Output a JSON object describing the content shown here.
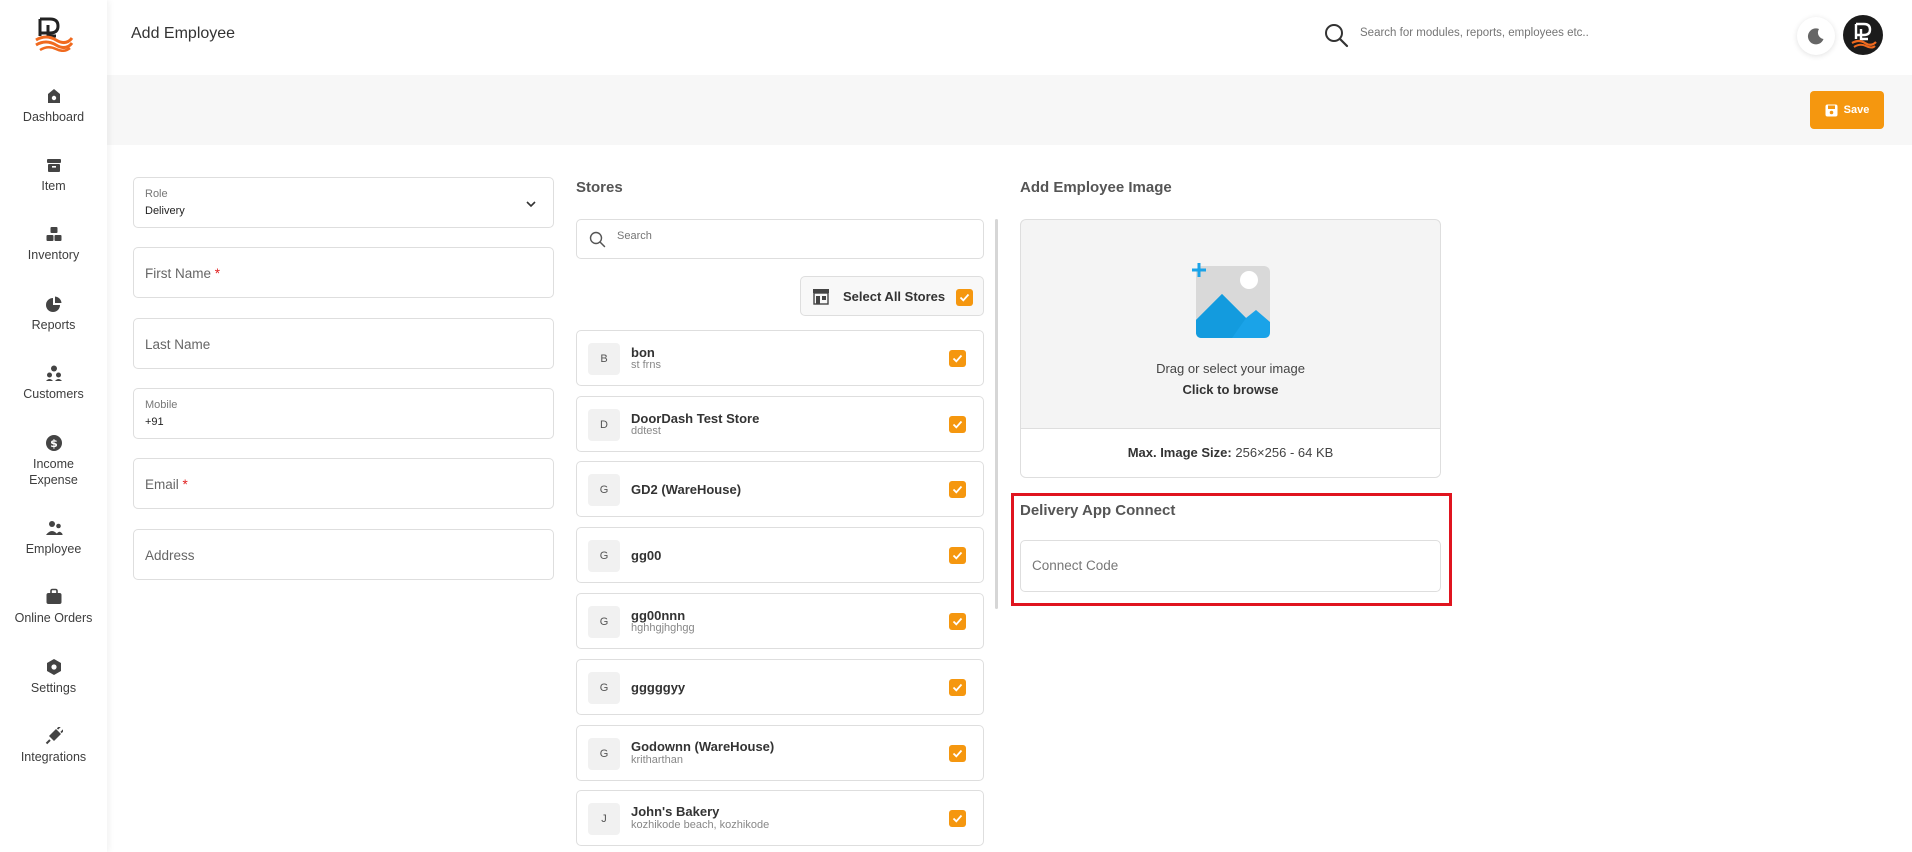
{
  "nav": {
    "items": [
      {
        "label": "Dashboard",
        "icon": "dashboard-icon"
      },
      {
        "label": "Item",
        "icon": "item-icon"
      },
      {
        "label": "Inventory",
        "icon": "inventory-icon"
      },
      {
        "label": "Reports",
        "icon": "pie-chart-icon"
      },
      {
        "label": "Customers",
        "icon": "customers-icon"
      },
      {
        "label": "Income Expense",
        "icon": "dollar-icon"
      },
      {
        "label": "Employee",
        "icon": "employee-icon"
      },
      {
        "label": "Online Orders",
        "icon": "bag-icon"
      },
      {
        "label": "Settings",
        "icon": "settings-icon"
      },
      {
        "label": "Integrations",
        "icon": "plug-icon"
      }
    ]
  },
  "header": {
    "title": "Add Employee",
    "search_placeholder": "Search for modules, reports, employees etc.."
  },
  "toolbar": {
    "save_label": "Save"
  },
  "form": {
    "role_label": "Role",
    "role_value": "Delivery",
    "first_name": "First Name",
    "last_name": "Last Name",
    "mobile_label": "Mobile",
    "mobile_value": "+91",
    "email": "Email",
    "address": "Address",
    "required_mark": "*"
  },
  "stores": {
    "title": "Stores",
    "search_placeholder": "Search",
    "select_all_label": "Select All Stores",
    "items": [
      {
        "initial": "B",
        "name": "bon",
        "sub": "st frns"
      },
      {
        "initial": "D",
        "name": "DoorDash Test Store",
        "sub": "ddtest"
      },
      {
        "initial": "G",
        "name": "GD2 (WareHouse)",
        "sub": ""
      },
      {
        "initial": "G",
        "name": "gg00",
        "sub": ""
      },
      {
        "initial": "G",
        "name": "gg00nnn",
        "sub": "hghhgjhghgg"
      },
      {
        "initial": "G",
        "name": "gggggyy",
        "sub": ""
      },
      {
        "initial": "G",
        "name": "Godownn (WareHouse)",
        "sub": "kritharthan"
      },
      {
        "initial": "J",
        "name": "John's Bakery",
        "sub": "kozhikode beach, kozhikode"
      }
    ]
  },
  "image_upload": {
    "title": "Add Employee Image",
    "line1": "Drag or select your image",
    "line2": "Click to browse",
    "max_label": "Max. Image Size:",
    "max_value": "256×256 - 64 KB"
  },
  "delivery_app": {
    "title": "Delivery App Connect",
    "placeholder": "Connect Code"
  },
  "colors": {
    "accent": "#f5970f",
    "highlight": "#e0141f",
    "brand_orange": "#f06a1f",
    "upload_blue": "#1aa3e8"
  }
}
